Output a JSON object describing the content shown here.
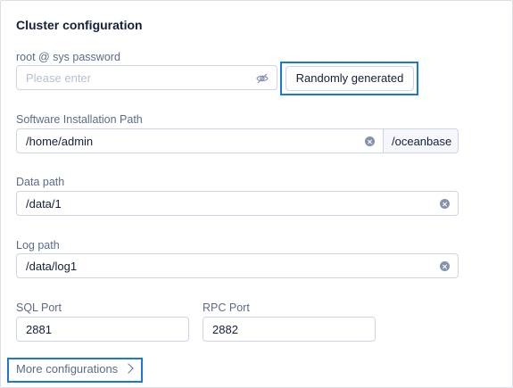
{
  "section": {
    "title": "Cluster configuration"
  },
  "password": {
    "label": "root @ sys password",
    "placeholder": "Please enter",
    "random_button": "Randomly generated"
  },
  "install_path": {
    "label": "Software Installation Path",
    "value": "/home/admin",
    "suffix": "/oceanbase"
  },
  "data_path": {
    "label": "Data path",
    "value": "/data/1"
  },
  "log_path": {
    "label": "Log path",
    "value": "/data/log1"
  },
  "sql_port": {
    "label": "SQL Port",
    "value": "2881"
  },
  "rpc_port": {
    "label": "RPC Port",
    "value": "2882"
  },
  "more": {
    "label": "More configurations"
  },
  "icons": {
    "password_toggle": "eye-invisible-icon",
    "clear": "close-circle-icon",
    "more": "chevron-right-icon"
  },
  "colors": {
    "highlight": "#1c76dc",
    "text": "#132039",
    "label": "#5c6b8a"
  }
}
